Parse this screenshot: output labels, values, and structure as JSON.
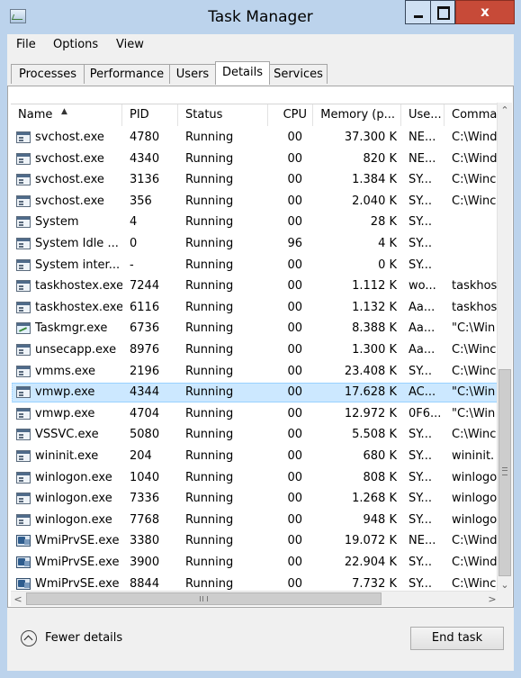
{
  "window": {
    "title": "Task Manager",
    "close_glyph": "x"
  },
  "menu": [
    "File",
    "Options",
    "View"
  ],
  "tabs": [
    "Processes",
    "Performance",
    "Users",
    "Details",
    "Services"
  ],
  "active_tab": "Details",
  "columns": [
    "Name",
    "PID",
    "Status",
    "CPU",
    "Memory (p...",
    "Use...",
    "Comma"
  ],
  "sort": {
    "column": "Name",
    "direction": "ascending",
    "glyph": "▲"
  },
  "rows": [
    {
      "icon": "process-window-icon",
      "name": "svchost.exe",
      "pid": "4780",
      "status": "Running",
      "cpu": "00",
      "memory": "37.300 K",
      "user": "NE...",
      "command": "C:\\Wind"
    },
    {
      "icon": "process-window-icon",
      "name": "svchost.exe",
      "pid": "4340",
      "status": "Running",
      "cpu": "00",
      "memory": "820 K",
      "user": "NE...",
      "command": "C:\\Wind"
    },
    {
      "icon": "process-window-icon",
      "name": "svchost.exe",
      "pid": "3136",
      "status": "Running",
      "cpu": "00",
      "memory": "1.384 K",
      "user": "SY...",
      "command": "C:\\Winc"
    },
    {
      "icon": "process-window-icon",
      "name": "svchost.exe",
      "pid": "356",
      "status": "Running",
      "cpu": "00",
      "memory": "2.040 K",
      "user": "SY...",
      "command": "C:\\Winc"
    },
    {
      "icon": "process-window-icon",
      "name": "System",
      "pid": "4",
      "status": "Running",
      "cpu": "00",
      "memory": "28 K",
      "user": "SY...",
      "command": ""
    },
    {
      "icon": "process-window-icon",
      "name": "System Idle ...",
      "pid": "0",
      "status": "Running",
      "cpu": "96",
      "memory": "4 K",
      "user": "SY...",
      "command": ""
    },
    {
      "icon": "process-window-icon",
      "name": "System inter...",
      "pid": "-",
      "status": "Running",
      "cpu": "00",
      "memory": "0 K",
      "user": "SY...",
      "command": ""
    },
    {
      "icon": "process-window-icon",
      "name": "taskhostex.exe",
      "pid": "7244",
      "status": "Running",
      "cpu": "00",
      "memory": "1.112 K",
      "user": "wo...",
      "command": "taskhos"
    },
    {
      "icon": "process-window-icon",
      "name": "taskhostex.exe",
      "pid": "6116",
      "status": "Running",
      "cpu": "00",
      "memory": "1.132 K",
      "user": "Aa...",
      "command": "taskhos"
    },
    {
      "icon": "task-manager-icon",
      "name": "Taskmgr.exe",
      "pid": "6736",
      "status": "Running",
      "cpu": "00",
      "memory": "8.388 K",
      "user": "Aa...",
      "command": "\"C:\\Win"
    },
    {
      "icon": "process-window-icon",
      "name": "unsecapp.exe",
      "pid": "8976",
      "status": "Running",
      "cpu": "00",
      "memory": "1.300 K",
      "user": "Aa...",
      "command": "C:\\Winc"
    },
    {
      "icon": "process-window-icon",
      "name": "vmms.exe",
      "pid": "2196",
      "status": "Running",
      "cpu": "00",
      "memory": "23.408 K",
      "user": "SY...",
      "command": "C:\\Winc"
    },
    {
      "icon": "process-window-icon",
      "name": "vmwp.exe",
      "pid": "4344",
      "status": "Running",
      "cpu": "00",
      "memory": "17.628 K",
      "user": "AC...",
      "command": "\"C:\\Win"
    },
    {
      "icon": "process-window-icon",
      "name": "vmwp.exe",
      "pid": "4704",
      "status": "Running",
      "cpu": "00",
      "memory": "12.972 K",
      "user": "0F6...",
      "command": "\"C:\\Win"
    },
    {
      "icon": "process-window-icon",
      "name": "VSSVC.exe",
      "pid": "5080",
      "status": "Running",
      "cpu": "00",
      "memory": "5.508 K",
      "user": "SY...",
      "command": "C:\\Winc"
    },
    {
      "icon": "process-window-icon",
      "name": "wininit.exe",
      "pid": "204",
      "status": "Running",
      "cpu": "00",
      "memory": "680 K",
      "user": "SY...",
      "command": "wininit."
    },
    {
      "icon": "process-window-icon",
      "name": "winlogon.exe",
      "pid": "1040",
      "status": "Running",
      "cpu": "00",
      "memory": "808 K",
      "user": "SY...",
      "command": "winlogo"
    },
    {
      "icon": "process-window-icon",
      "name": "winlogon.exe",
      "pid": "7336",
      "status": "Running",
      "cpu": "00",
      "memory": "1.268 K",
      "user": "SY...",
      "command": "winlogo"
    },
    {
      "icon": "process-window-icon",
      "name": "winlogon.exe",
      "pid": "7768",
      "status": "Running",
      "cpu": "00",
      "memory": "948 K",
      "user": "SY...",
      "command": "winlogo"
    },
    {
      "icon": "wmi-provider-icon",
      "name": "WmiPrvSE.exe",
      "pid": "3380",
      "status": "Running",
      "cpu": "00",
      "memory": "19.072 K",
      "user": "NE...",
      "command": "C:\\Wind"
    },
    {
      "icon": "wmi-provider-icon",
      "name": "WmiPrvSE.exe",
      "pid": "3900",
      "status": "Running",
      "cpu": "00",
      "memory": "22.904 K",
      "user": "SY...",
      "command": "C:\\Wind"
    },
    {
      "icon": "wmi-provider-icon",
      "name": "WmiPrvSE.exe",
      "pid": "8844",
      "status": "Running",
      "cpu": "00",
      "memory": "7.732 K",
      "user": "SY...",
      "command": "C:\\Winc"
    }
  ],
  "selected_row_index": 12,
  "footer": {
    "fewer_details": "Fewer details",
    "end_task": "End task"
  },
  "scrollbar_glyphs": {
    "up": "⌃",
    "down": "⌄",
    "left": "<",
    "right": ">"
  },
  "colors": {
    "titlebar": "#bcd3ec",
    "close_button": "#c74a38",
    "selection_fill": "#cce8ff",
    "selection_border": "#99d1ff"
  }
}
